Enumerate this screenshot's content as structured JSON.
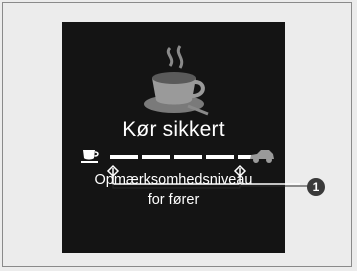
{
  "screen": {
    "title": "Kør sikkert",
    "label_line1": "Opmærksomhedsniveau",
    "label_line2": "for fører",
    "attention_level": {
      "segments_total": 5,
      "segments_filled": 5
    },
    "colors": {
      "screen_background": "#141414",
      "text": "#ffffff",
      "segment": "#ffffff"
    },
    "icons": [
      "coffee-cup-icon",
      "small-cup-icon",
      "car-icon"
    ]
  },
  "callout": {
    "number": "1"
  }
}
